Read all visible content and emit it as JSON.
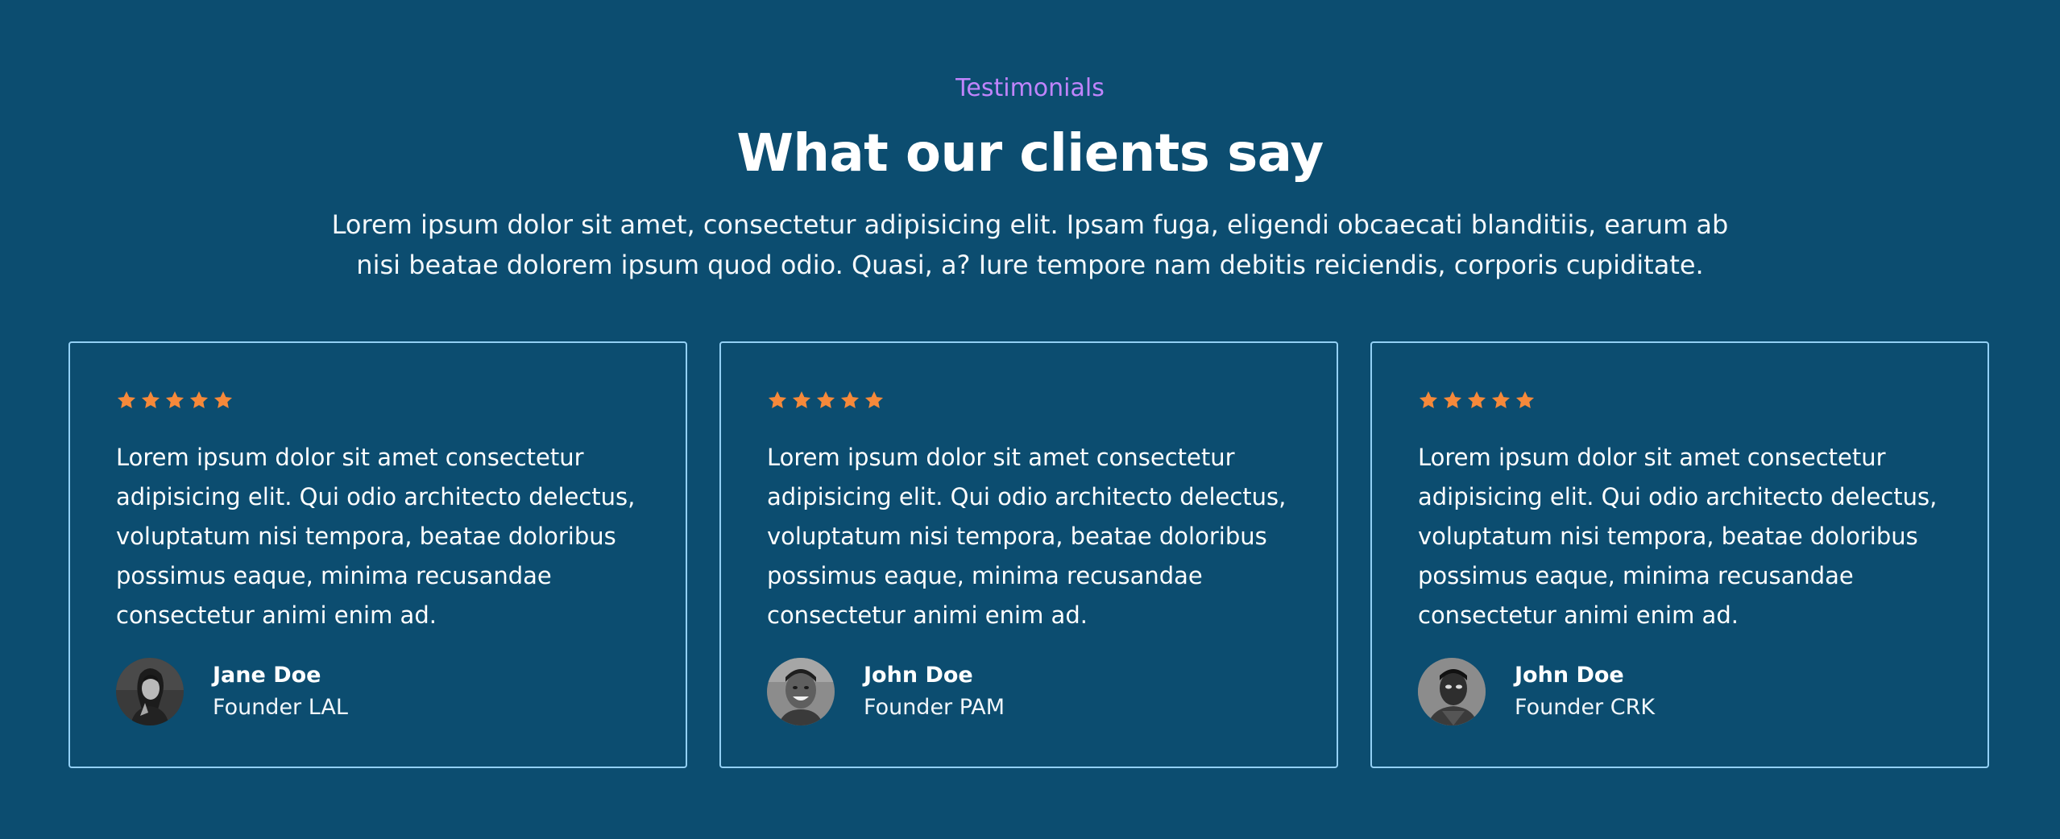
{
  "section": {
    "eyebrow": "Testimonials",
    "title": "What our clients say",
    "intro": "Lorem ipsum dolor sit amet, consectetur adipisicing elit. Ipsam fuga, eligendi obcaecati blanditiis, earum ab nisi beatae dolorem ipsum quod odio. Quasi, a? Iure tempore nam debitis reiciendis, corporis cupiditate."
  },
  "colors": {
    "background": "#0c4d70",
    "eyebrow": "#c084fc",
    "card_border": "#93d0f5",
    "star": "#f6893a"
  },
  "testimonials": [
    {
      "rating": 5,
      "quote": "Lorem ipsum dolor sit amet consectetur adipisicing elit. Qui odio architecto delectus, voluptatum nisi tempora, beatae doloribus possimus eaque, minima recusandae consectetur animi enim ad.",
      "name": "Jane Doe",
      "role": "Founder LAL",
      "avatar_icon": "avatar-woman-photo"
    },
    {
      "rating": 5,
      "quote": "Lorem ipsum dolor sit amet consectetur adipisicing elit. Qui odio architecto delectus, voluptatum nisi tempora, beatae doloribus possimus eaque, minima recusandae consectetur animi enim ad.",
      "name": "John Doe",
      "role": "Founder PAM",
      "avatar_icon": "avatar-man-smiling-photo"
    },
    {
      "rating": 5,
      "quote": "Lorem ipsum dolor sit amet consectetur adipisicing elit. Qui odio architecto delectus, voluptatum nisi tempora, beatae doloribus possimus eaque, minima recusandae consectetur animi enim ad.",
      "name": "John Doe",
      "role": "Founder CRK",
      "avatar_icon": "avatar-man-photo"
    }
  ]
}
